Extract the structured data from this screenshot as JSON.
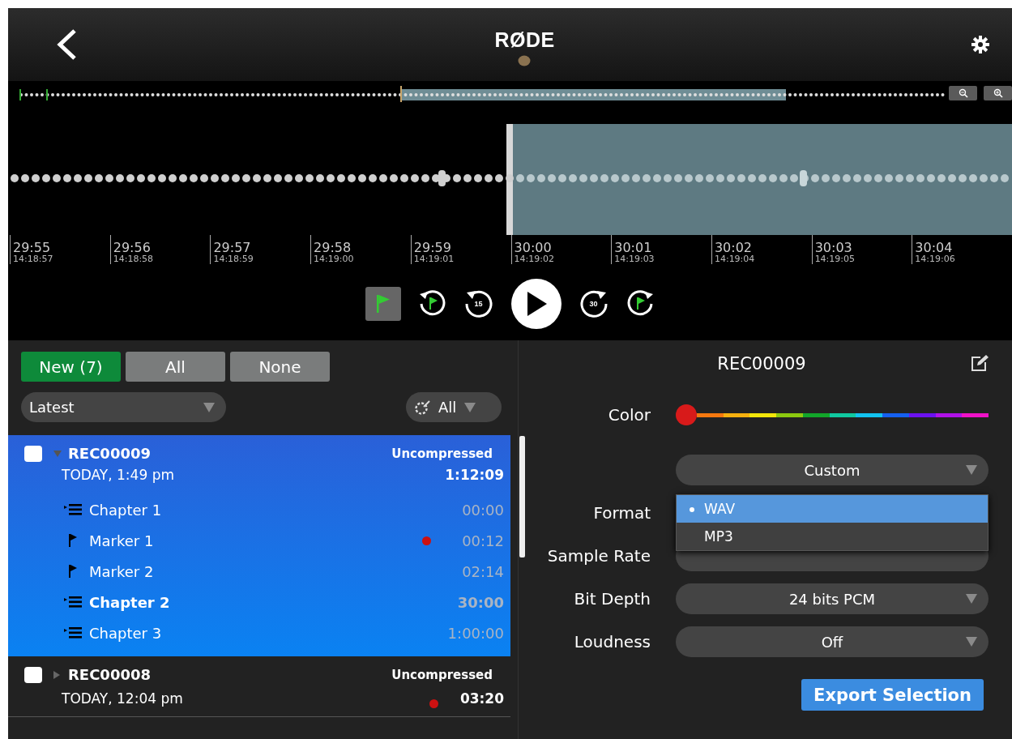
{
  "header": {
    "logo": "RØDE"
  },
  "timeline": {
    "ticks": [
      {
        "time": "29:55",
        "clock": "14:18:57"
      },
      {
        "time": "29:56",
        "clock": "14:18:58"
      },
      {
        "time": "29:57",
        "clock": "14:18:59"
      },
      {
        "time": "29:58",
        "clock": "14:19:00"
      },
      {
        "time": "29:59",
        "clock": "14:19:01"
      },
      {
        "time": "30:00",
        "clock": "14:19:02"
      },
      {
        "time": "30:01",
        "clock": "14:19:03"
      },
      {
        "time": "30:02",
        "clock": "14:19:04"
      },
      {
        "time": "30:03",
        "clock": "14:19:05"
      },
      {
        "time": "30:04",
        "clock": "14:19:06"
      }
    ]
  },
  "transport": {
    "marker_mode_on": true,
    "skip_back_label": "15",
    "skip_forward_label": "30"
  },
  "filter_tabs": [
    {
      "label": "New (7)",
      "selected": true
    },
    {
      "label": "All",
      "selected": false
    },
    {
      "label": "None",
      "selected": false
    }
  ],
  "sort": {
    "value": "Latest"
  },
  "color_filter": {
    "value": "All"
  },
  "recordings": [
    {
      "name": "REC00009",
      "date": "TODAY, 1:49 pm",
      "format": "Uncompressed",
      "duration": "1:12:09",
      "selected": true,
      "checked": false,
      "expanded": true,
      "dot": false,
      "children": [
        {
          "kind": "chapter",
          "label": "Chapter 1",
          "time": "00:00",
          "selected": false,
          "dot": false
        },
        {
          "kind": "marker",
          "label": "Marker 1",
          "time": "00:12",
          "selected": false,
          "dot": true
        },
        {
          "kind": "marker",
          "label": "Marker 2",
          "time": "02:14",
          "selected": false,
          "dot": false
        },
        {
          "kind": "chapter",
          "label": "Chapter 2",
          "time": "30:00",
          "selected": true,
          "dot": false
        },
        {
          "kind": "chapter",
          "label": "Chapter 3",
          "time": "1:00:00",
          "selected": false,
          "dot": false
        }
      ]
    },
    {
      "name": "REC00008",
      "date": "TODAY, 12:04 pm",
      "format": "Uncompressed",
      "duration": "03:20",
      "selected": false,
      "checked": false,
      "expanded": false,
      "dot": true
    }
  ],
  "details": {
    "title": "REC00009",
    "color_label": "Color",
    "colors": [
      {
        "color": "#d81a1a",
        "selected": true
      },
      {
        "color": "#f5780f",
        "selected": false
      },
      {
        "color": "#f5b00f",
        "selected": false
      },
      {
        "color": "#f2e60a",
        "selected": false
      },
      {
        "color": "#8cc90f",
        "selected": false
      },
      {
        "color": "#12a52a",
        "selected": false
      },
      {
        "color": "#10c9a0",
        "selected": false
      },
      {
        "color": "#12c3f0",
        "selected": false
      },
      {
        "color": "#1560f0",
        "selected": false
      },
      {
        "color": "#6c12f0",
        "selected": false
      },
      {
        "color": "#b012e8",
        "selected": false
      },
      {
        "color": "#f012c8",
        "selected": false
      }
    ],
    "preset": {
      "value": "Custom"
    },
    "settings": [
      {
        "label": "Format",
        "kind": "menu",
        "options": [
          {
            "label": "WAV",
            "selected": true
          },
          {
            "label": "MP3",
            "selected": false
          }
        ]
      },
      {
        "label": "Sample Rate",
        "kind": "hidden"
      },
      {
        "label": "Bit Depth",
        "kind": "dropdown",
        "value": "24 bits PCM"
      },
      {
        "label": "Loudness",
        "kind": "dropdown",
        "value": "Off"
      }
    ],
    "export_button": "Export Selection"
  }
}
